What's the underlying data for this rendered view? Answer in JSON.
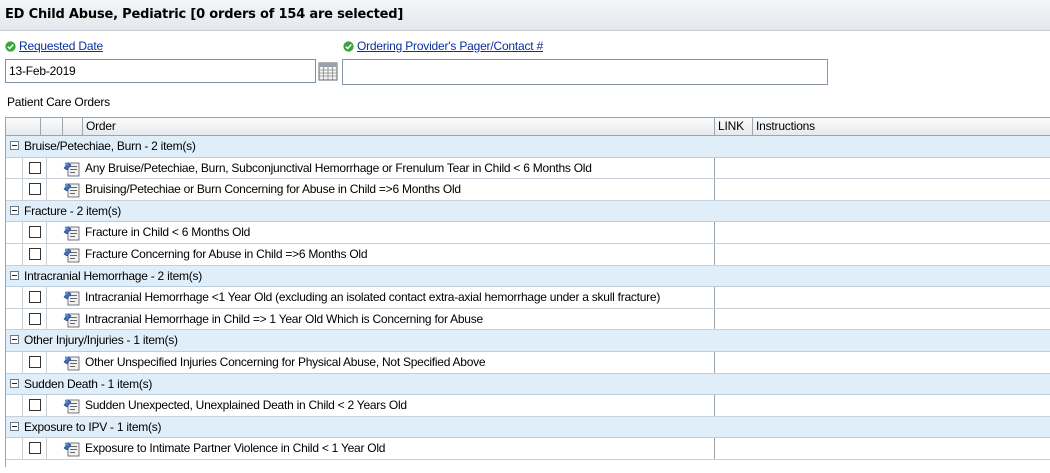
{
  "title": "ED Child Abuse, Pediatric  [0 orders of 154 are selected]",
  "requested_date": {
    "label": "Requested Date",
    "value": "13-Feb-2019"
  },
  "ordering_provider": {
    "label": "Ordering Provider's Pager/Contact #",
    "value": ""
  },
  "section_label": "Patient Care Orders",
  "columns": {
    "order": "Order",
    "link": "LINK",
    "instructions": "Instructions"
  },
  "groups": [
    {
      "label": "Bruise/Petechiae, Burn - 2 item(s)",
      "items": [
        "Any Bruise/Petechiae, Burn, Subconjunctival Hemorrhage or Frenulum Tear in Child < 6 Months Old",
        "Bruising/Petechiae or Burn Concerning for Abuse in Child =>6 Months Old"
      ]
    },
    {
      "label": "Fracture - 2 item(s)",
      "items": [
        "Fracture in Child < 6 Months Old",
        "Fracture Concerning for Abuse in Child =>6 Months Old"
      ]
    },
    {
      "label": "Intracranial Hemorrhage - 2 item(s)",
      "items": [
        "Intracranial Hemorrhage <1 Year Old (excluding an isolated contact extra-axial hemorrhage under a skull fracture)",
        "Intracranial Hemorrhage in Child => 1 Year Old Which is Concerning for Abuse"
      ]
    },
    {
      "label": "Other Injury/Injuries - 1 item(s)",
      "items": [
        "Other Unspecified Injuries Concerning for Physical Abuse, Not Specified Above"
      ]
    },
    {
      "label": "Sudden Death - 1 item(s)",
      "items": [
        "Sudden Unexpected, Unexplained Death in Child < 2 Years Old"
      ]
    },
    {
      "label": "Exposure to IPV - 1 item(s)",
      "items": [
        "Exposure to Intimate Partner Violence in Child < 1 Year Old"
      ]
    }
  ],
  "colors": {
    "group_row_bg": "#dfeef9",
    "link_color": "#0a2f9e",
    "required_check": "#3aa33a"
  },
  "icons": {
    "required": "green-check-icon",
    "calendar": "calendar-icon",
    "order": "order-sentence-icon",
    "collapse": "minus-box-icon"
  }
}
